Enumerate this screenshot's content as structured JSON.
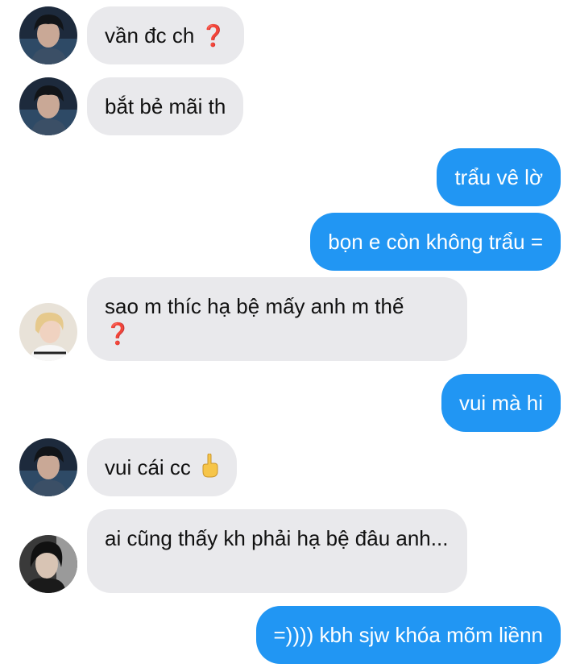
{
  "messages": [
    {
      "side": "in",
      "text": "vần đc ch",
      "suffix": "❓",
      "avatar": "avatar-dark-hair"
    },
    {
      "side": "in",
      "text": "bắt bẻ mãi th",
      "avatar": "avatar-dark-hair"
    },
    {
      "side": "out",
      "text": "trẩu vê lờ"
    },
    {
      "side": "out",
      "text": "bọn e còn không trẩu ="
    },
    {
      "side": "in",
      "text": "sao m thíc hạ bệ mấy anh m thế",
      "suffix": "❓",
      "avatar": "avatar-blonde"
    },
    {
      "side": "out",
      "text": "vui mà hi"
    },
    {
      "side": "in",
      "text": "vui cái cc",
      "suffix_icon": "middle-finger-emoji",
      "avatar": "avatar-dark-hair"
    },
    {
      "side": "in",
      "text": "ai cũng thấy kh phải hạ bệ đâu anh...",
      "avatar": "avatar-dark-hood"
    },
    {
      "side": "out",
      "text": "=)))) kbh sjw khóa mõm liềnn"
    }
  ],
  "colors": {
    "incoming_bubble": "#e9e9ec",
    "outgoing_bubble": "#2196f3",
    "question_mark": "#e02020"
  }
}
